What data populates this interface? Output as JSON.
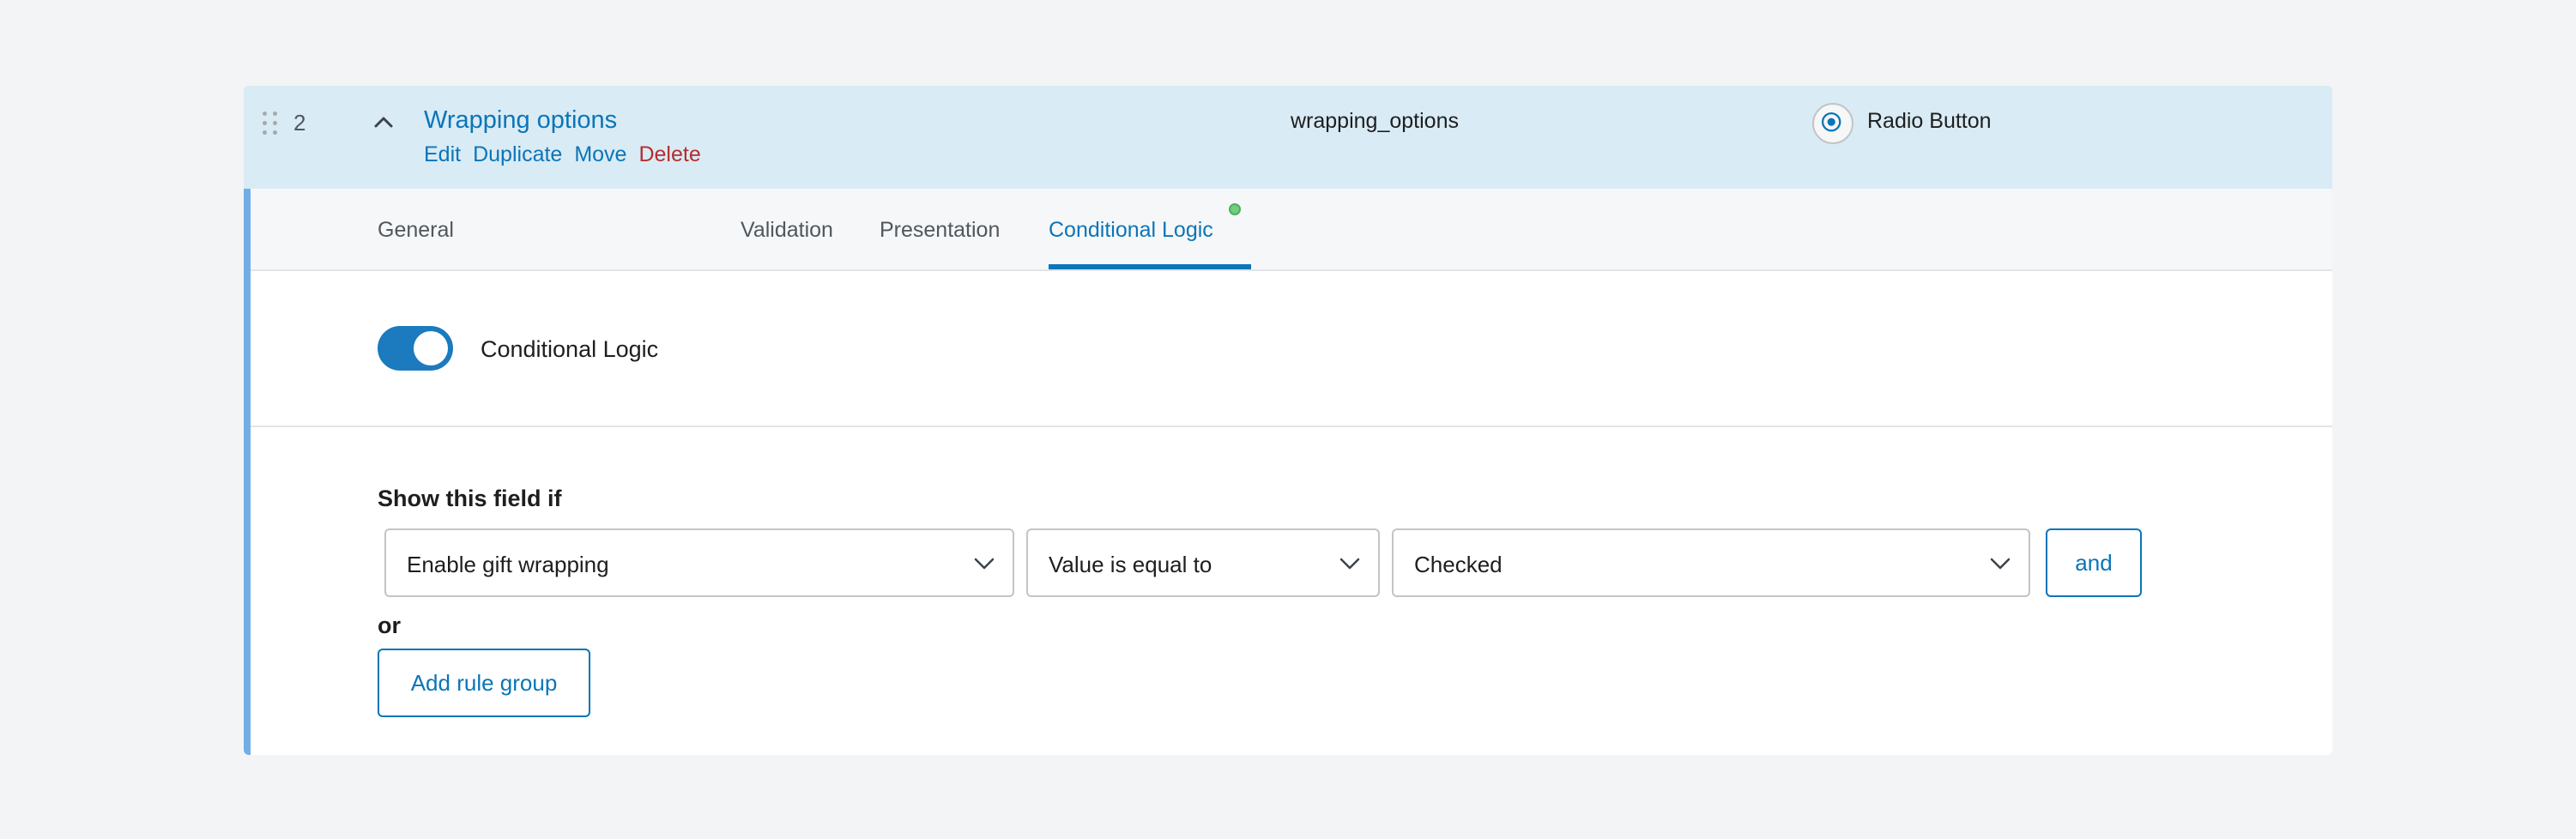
{
  "field": {
    "order": "2",
    "label": "Wrapping options",
    "actions": {
      "edit": "Edit",
      "duplicate": "Duplicate",
      "move": "Move",
      "delete": "Delete"
    },
    "name": "wrapping_options",
    "type_icon": "radio-button-icon",
    "type_label": "Radio Button"
  },
  "tabs": [
    {
      "label": "General",
      "active": false
    },
    {
      "label": "Validation",
      "active": false
    },
    {
      "label": "Presentation",
      "active": false
    },
    {
      "label": "Conditional Logic",
      "active": true,
      "indicator": "status-dot",
      "indicator_color": "#6fcf7f"
    }
  ],
  "conditional_logic": {
    "toggle_label": "Conditional Logic",
    "enabled": true,
    "rule_group_label": "Show this field if",
    "rule": {
      "field": "Enable gift wrapping",
      "operator": "Value is equal to",
      "value": "Checked"
    },
    "and_button": "and",
    "or_label": "or",
    "add_rule_group_button": "Add rule group"
  },
  "colors": {
    "accent": "#0a75b8",
    "header_bg": "#d9ebf5",
    "delete": "#b32d2e",
    "toggle_on": "#1c7abf"
  }
}
